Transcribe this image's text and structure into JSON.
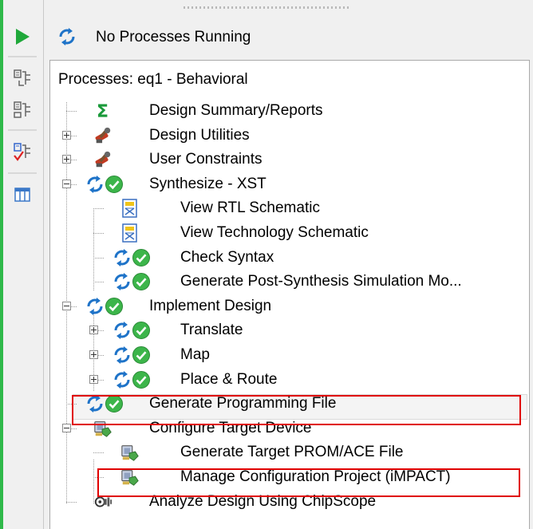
{
  "status": {
    "text": "No Processes Running"
  },
  "panel": {
    "title": "Processes: eq1 - Behavioral"
  },
  "tree": [
    {
      "label": "Design Summary/Reports",
      "icon": "sigma-icon"
    },
    {
      "label": "Design Utilities",
      "icon": "tools-icon"
    },
    {
      "label": "User Constraints",
      "icon": "tools-icon"
    },
    {
      "label": "Synthesize - XST",
      "icon": "refresh-check-icon",
      "status": "complete"
    },
    {
      "label": "View RTL Schematic",
      "icon": "schematic-doc-icon"
    },
    {
      "label": "View Technology Schematic",
      "icon": "schematic-doc-icon"
    },
    {
      "label": "Check Syntax",
      "icon": "refresh-check-icon",
      "status": "complete"
    },
    {
      "label": "Generate Post-Synthesis Simulation Mo...",
      "icon": "refresh-check-icon",
      "status": "complete"
    },
    {
      "label": "Implement Design",
      "icon": "refresh-check-icon",
      "status": "complete"
    },
    {
      "label": "Translate",
      "icon": "refresh-check-icon",
      "status": "complete"
    },
    {
      "label": "Map",
      "icon": "refresh-check-icon",
      "status": "complete"
    },
    {
      "label": "Place & Route",
      "icon": "refresh-check-icon",
      "status": "complete"
    },
    {
      "label": "Generate Programming File",
      "icon": "refresh-check-icon",
      "status": "complete"
    },
    {
      "label": "Configure Target Device",
      "icon": "device-config-icon"
    },
    {
      "label": "Generate Target PROM/ACE File",
      "icon": "device-config-icon"
    },
    {
      "label": "Manage Configuration Project (iMPACT)",
      "icon": "device-config-icon"
    },
    {
      "label": "Analyze Design Using ChipScope",
      "icon": "chipscope-icon"
    }
  ],
  "colors": {
    "accent_green": "#2fb94a",
    "refresh_blue": "#1e73c8",
    "check_green": "#3cb54a",
    "highlight_red": "#e00000"
  }
}
